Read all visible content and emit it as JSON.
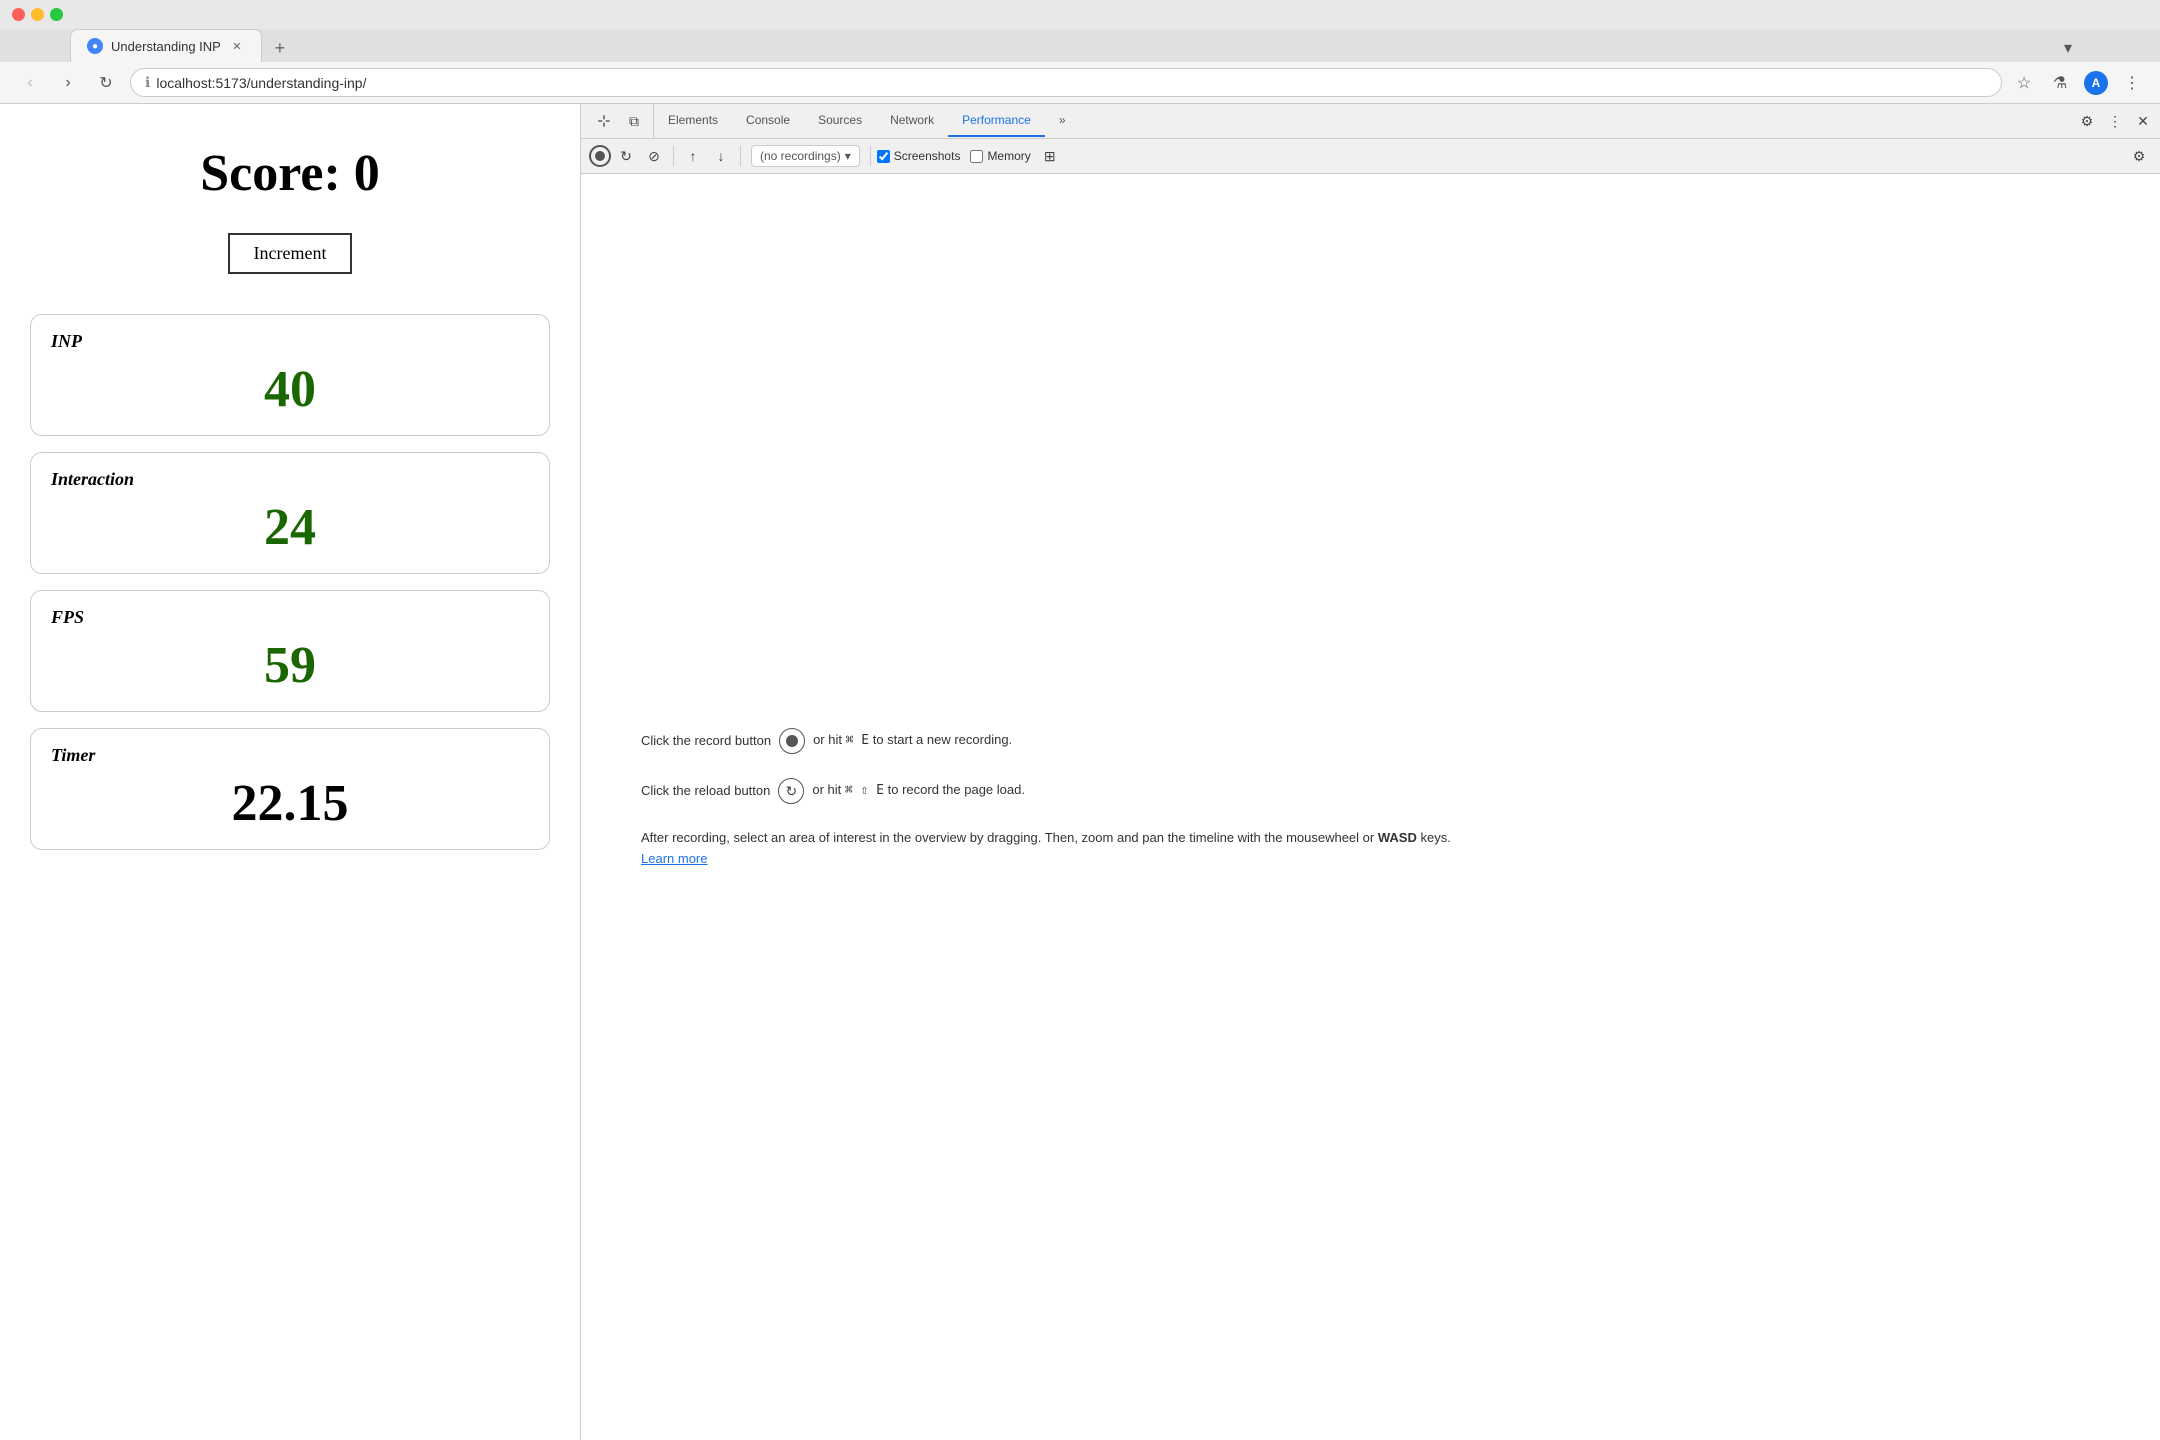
{
  "browser": {
    "tab_title": "Understanding INP",
    "url": "localhost:5173/understanding-inp/",
    "new_tab_symbol": "+",
    "dropdown_symbol": "▾"
  },
  "devtools": {
    "tabs": [
      "Elements",
      "Console",
      "Sources",
      "Network",
      "Performance"
    ],
    "active_tab": "Performance",
    "more_tabs_symbol": "»",
    "recordings_placeholder": "(no recordings)",
    "screenshots_label": "Screenshots",
    "memory_label": "Memory",
    "screenshots_checked": true,
    "memory_checked": false
  },
  "webpage": {
    "score_label": "Score: 0",
    "increment_button": "Increment",
    "metrics": [
      {
        "id": "inp",
        "label": "INP",
        "value": "40",
        "is_timer": false
      },
      {
        "id": "interaction",
        "label": "Interaction",
        "value": "24",
        "is_timer": false
      },
      {
        "id": "fps",
        "label": "FPS",
        "value": "59",
        "is_timer": false
      },
      {
        "id": "timer",
        "label": "Timer",
        "value": "22.15",
        "is_timer": true
      }
    ]
  },
  "devtools_content": {
    "record_instruction": "Click the record button",
    "record_shortcut": "⌘ E",
    "record_suffix": "to start a new recording.",
    "reload_instruction": "Click the reload button",
    "reload_shortcut": "⌘ ⇧ E",
    "reload_suffix": "to record the page load.",
    "detail_text": "After recording, select an area of interest in the overview by dragging. Then, zoom and pan the timeline with the mousewheel or",
    "wasd_label": "WASD",
    "detail_suffix": "keys.",
    "learn_more": "Learn more"
  }
}
